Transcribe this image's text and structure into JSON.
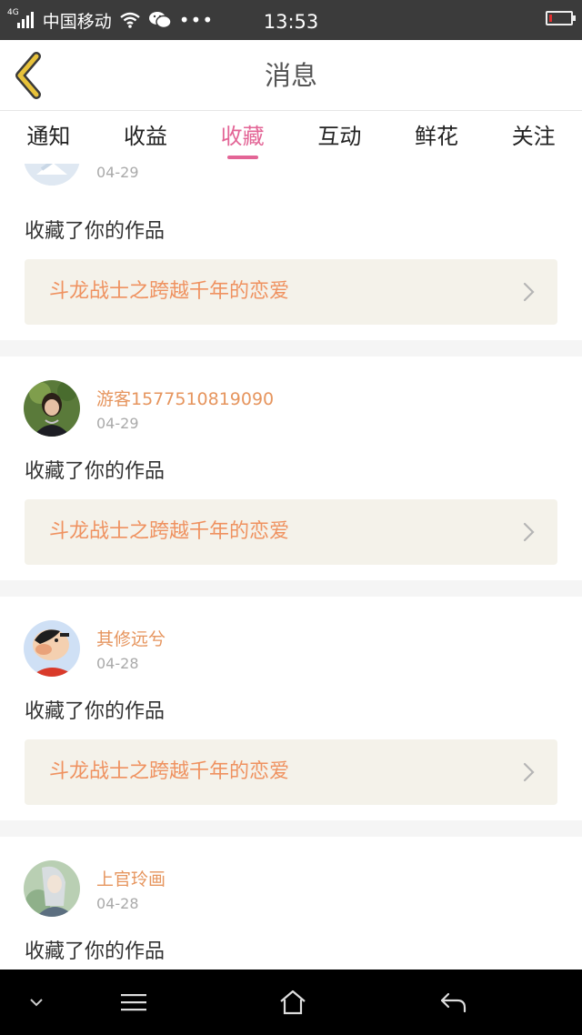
{
  "status_bar": {
    "network": "4G",
    "carrier": "中国移动",
    "wechat_icon": "wechat-icon",
    "more": "•••",
    "time": "13:53",
    "battery_color": "#e03030"
  },
  "header": {
    "title": "消息",
    "back_icon": "chevron-left-icon",
    "back_color": "#e8c23a"
  },
  "tabs": [
    {
      "label": "通知",
      "active": false
    },
    {
      "label": "收益",
      "active": false
    },
    {
      "label": "收藏",
      "active": true
    },
    {
      "label": "互动",
      "active": false
    },
    {
      "label": "鲜花",
      "active": false
    },
    {
      "label": "关注",
      "active": false
    }
  ],
  "accent_color": "#e36596",
  "feed": [
    {
      "user": "",
      "date": "04-29",
      "action": "收藏了你的作品",
      "work": "斗龙战士之跨越千年的恋爱"
    },
    {
      "user": "游客1577510819090",
      "date": "04-29",
      "action": "收藏了你的作品",
      "work": "斗龙战士之跨越千年的恋爱"
    },
    {
      "user": "其修远兮",
      "date": "04-28",
      "action": "收藏了你的作品",
      "work": "斗龙战士之跨越千年的恋爱"
    },
    {
      "user": "上官玲画",
      "date": "04-28",
      "action": "收藏了你的作品",
      "work": ""
    }
  ],
  "nav_bar": {
    "icons": [
      "chevron-down-icon",
      "menu-icon",
      "home-icon",
      "back-arrow-icon"
    ]
  }
}
